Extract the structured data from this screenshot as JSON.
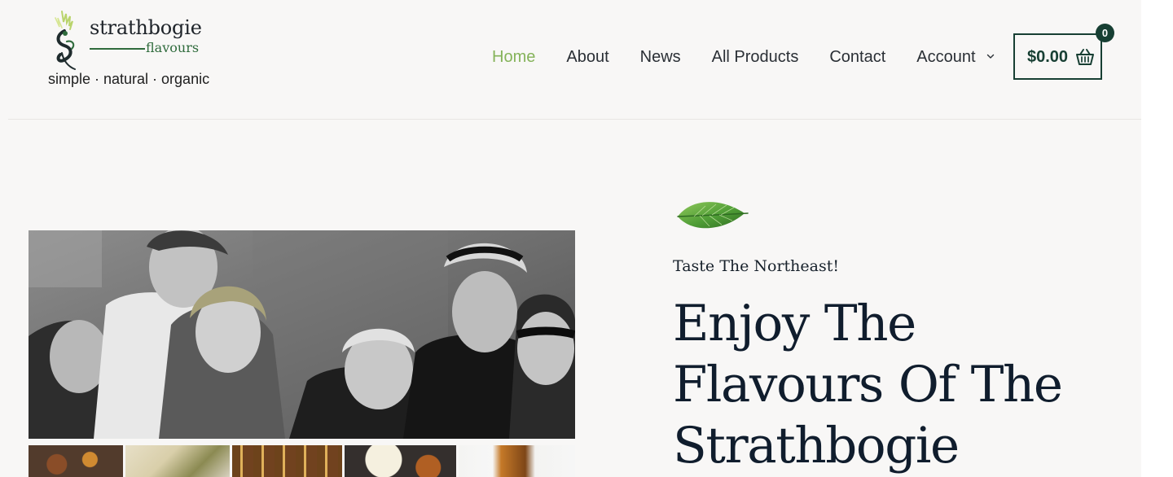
{
  "brand": {
    "name": "strathbogie",
    "sub": "flavours",
    "tagline": "simple · natural · organic",
    "logo_icon": "thistle-leaf-icon"
  },
  "nav": {
    "items": [
      {
        "label": "Home",
        "active": true
      },
      {
        "label": "About",
        "active": false
      },
      {
        "label": "News",
        "active": false
      },
      {
        "label": "All Products",
        "active": false
      },
      {
        "label": "Contact",
        "active": false
      },
      {
        "label": "Account",
        "active": false,
        "has_dropdown": true
      }
    ],
    "dropdown_icon": "chevron-down-icon"
  },
  "cart": {
    "total": "$0.00",
    "count": "0",
    "icon": "basket-icon"
  },
  "hero": {
    "leaf_icon": "leaf-icon",
    "eyebrow": "Taste The Northeast!",
    "heading_lines": [
      "Enjoy The",
      "Flavours Of The",
      "Strathbogie"
    ],
    "family_photo_alt": "family-photo",
    "spice_tiles": [
      "spice-tile-1",
      "spice-tile-2",
      "spice-tile-3",
      "spice-tile-4",
      "spice-tile-5"
    ]
  },
  "colors": {
    "background": "#f8f7f6",
    "accent_green": "#85b35a",
    "dark_green": "#173f33",
    "text_dark": "#101d2d"
  }
}
